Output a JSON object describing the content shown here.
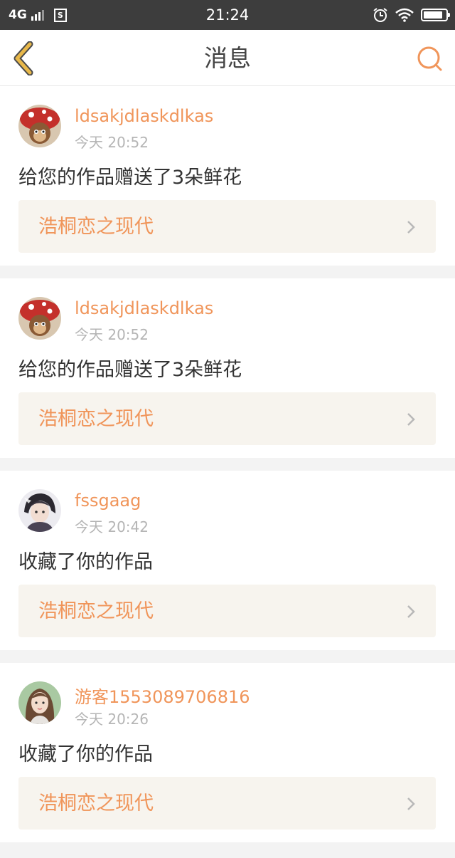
{
  "status_bar": {
    "network": "4G",
    "sim_label": "S",
    "time": "21:24",
    "battery_level": 0.85
  },
  "nav": {
    "title": "消息"
  },
  "colors": {
    "accent": "#f0955a",
    "back_icon": "#e8b84a",
    "card_link_bg": "#f7f4ee"
  },
  "messages": [
    {
      "username": "ldsakjdlaskdlkas",
      "time": "今天 20:52",
      "text": "给您的作品赠送了3朵鲜花",
      "work_title": "浩桐恋之现代",
      "avatar": "mushroom-avatar"
    },
    {
      "username": "ldsakjdlaskdlkas",
      "time": "今天 20:52",
      "text": "给您的作品赠送了3朵鲜花",
      "work_title": "浩桐恋之现代",
      "avatar": "mushroom-avatar"
    },
    {
      "username": "fssgaag",
      "time": "今天 20:42",
      "text": "收藏了你的作品",
      "work_title": "浩桐恋之现代",
      "avatar": "anime-avatar"
    },
    {
      "username": "游客1553089706816",
      "time": "今天 20:26",
      "text": "收藏了你的作品",
      "work_title": "浩桐恋之现代",
      "avatar": "girl-avatar"
    }
  ]
}
